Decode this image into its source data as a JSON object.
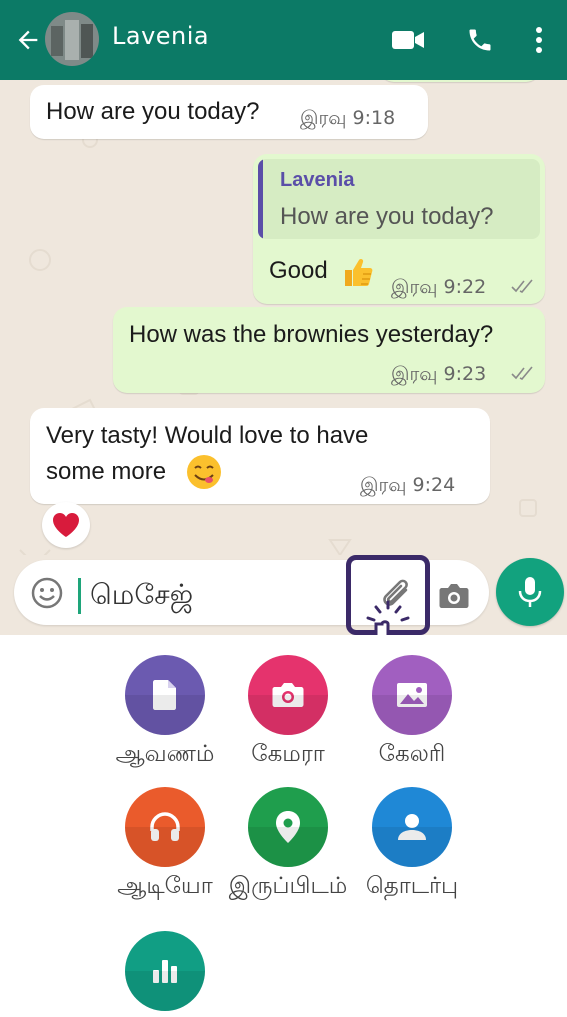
{
  "header": {
    "contact_name": "Lavenia",
    "background": "#0c7a66"
  },
  "messages": [
    {
      "direction": "incoming",
      "text": "How are you today?",
      "time": "இரவு 9:18"
    },
    {
      "direction": "outgoing",
      "quote_name": "Lavenia",
      "quote_text": "How are you today?",
      "text": "Good",
      "emoji": "thumbs-up",
      "time": "இரவு 9:22",
      "status": "read"
    },
    {
      "direction": "outgoing",
      "text": "How was the brownies yesterday?",
      "time": "இரவு 9:23",
      "status": "read"
    },
    {
      "direction": "incoming",
      "text_line1": "Very tasty! Would love to have",
      "text_line2": "some more",
      "emoji": "yum-face",
      "time": "இரவு 9:24",
      "reaction": "heart"
    }
  ],
  "input": {
    "placeholder": "மெசேஜ்"
  },
  "attachments": [
    {
      "label": "ஆவணம்",
      "icon": "document-icon",
      "color": "#6b5ab0"
    },
    {
      "label": "கேமரா",
      "icon": "camera-icon",
      "color": "#e5336d"
    },
    {
      "label": "கேலரி",
      "icon": "gallery-icon",
      "color": "#a15fc0"
    },
    {
      "label": "ஆடியோ",
      "icon": "headphones-icon",
      "color": "#ea5b2c"
    },
    {
      "label": "இருப்பிடம்",
      "icon": "location-icon",
      "color": "#1f9e4d"
    },
    {
      "label": "தொடர்பு",
      "icon": "contact-icon",
      "color": "#1f88d6"
    },
    {
      "label": "",
      "icon": "poll-icon",
      "color": "#119e84"
    }
  ]
}
